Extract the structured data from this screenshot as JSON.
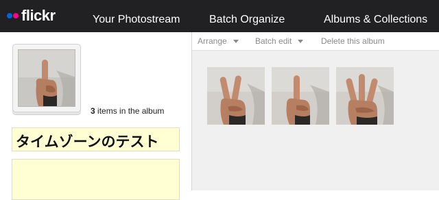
{
  "header": {
    "logo_text": "flickr",
    "nav": [
      "Your Photostream",
      "Batch Organize",
      "Albums & Collections"
    ]
  },
  "album": {
    "item_count": "3",
    "items_suffix": " items in the album",
    "title": "タイムゾーンのテスト",
    "description": ""
  },
  "toolbar": {
    "arrange_label": "Arrange",
    "batch_edit_label": "Batch edit",
    "delete_label": "Delete this album"
  },
  "photos": [
    {
      "icon": "two-fingers-photo"
    },
    {
      "icon": "one-finger-photo"
    },
    {
      "icon": "three-fingers-photo"
    }
  ],
  "colors": {
    "topbar": "#212124",
    "logo_blue": "#0063dc",
    "logo_pink": "#ff0084",
    "field_bg": "#ffffd3"
  }
}
